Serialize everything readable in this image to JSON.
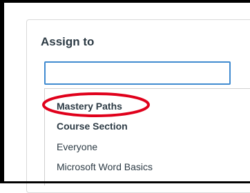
{
  "assign": {
    "label": "Assign to",
    "search": {
      "value": "",
      "placeholder": ""
    },
    "options": [
      {
        "label": "Mastery Paths",
        "type": "group"
      },
      {
        "label": "Course Section",
        "type": "group"
      },
      {
        "label": "Everyone",
        "type": "item"
      },
      {
        "label": "Microsoft Word Basics",
        "type": "item"
      }
    ]
  },
  "annotation": {
    "highlight_color": "#e0001b",
    "highlighted_option": "Mastery Paths"
  },
  "colors": {
    "focus_border": "#3f8ad0",
    "text": "#2d3b45",
    "panel_border": "#d9d9d9"
  }
}
